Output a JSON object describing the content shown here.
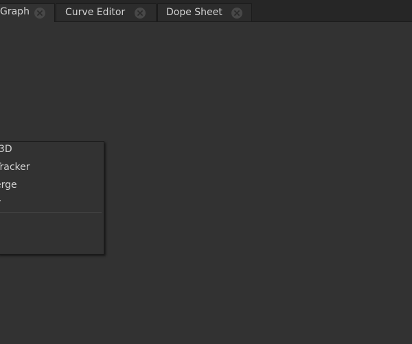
{
  "tabs": [
    {
      "label": "Graph",
      "active": true,
      "close_icon": "close-icon"
    },
    {
      "label": "Curve Editor",
      "active": false,
      "close_icon": "close-icon"
    },
    {
      "label": "Dope Sheet",
      "active": false,
      "close_icon": "close-icon"
    }
  ],
  "context_menu": {
    "items": [
      {
        "label": "3D"
      },
      {
        "label": "Tracker"
      },
      {
        "label": "erge"
      },
      {
        "label": "r"
      }
    ]
  },
  "colors": {
    "background": "#323232",
    "tabbar": "#262626",
    "text": "#d2d2d2"
  }
}
